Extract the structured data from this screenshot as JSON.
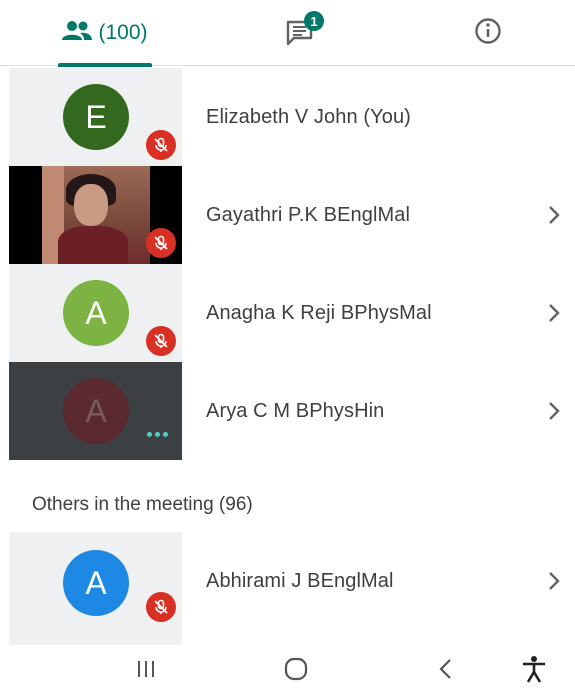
{
  "tabs": {
    "people_count": "(100)",
    "chat_badge": "1"
  },
  "participants": [
    {
      "initial": "E",
      "name": "Elizabeth V John (You)",
      "avatar_color": "#33691e"
    },
    {
      "name": "Gayathri P.K BEnglMal"
    },
    {
      "initial": "A",
      "name": "Anagha K Reji BPhysMal",
      "avatar_color": "#7cb342"
    },
    {
      "initial": "A",
      "name": "Arya C M BPhysHin",
      "avatar_color": "#6d1f26"
    }
  ],
  "others": {
    "label": "Others in the meeting (96)",
    "items": [
      {
        "initial": "A",
        "name": "Abhirami J BEnglMal",
        "avatar_color": "#1e88e5"
      }
    ]
  },
  "colors": {
    "accent": "#00796b",
    "mute": "#d93025"
  }
}
